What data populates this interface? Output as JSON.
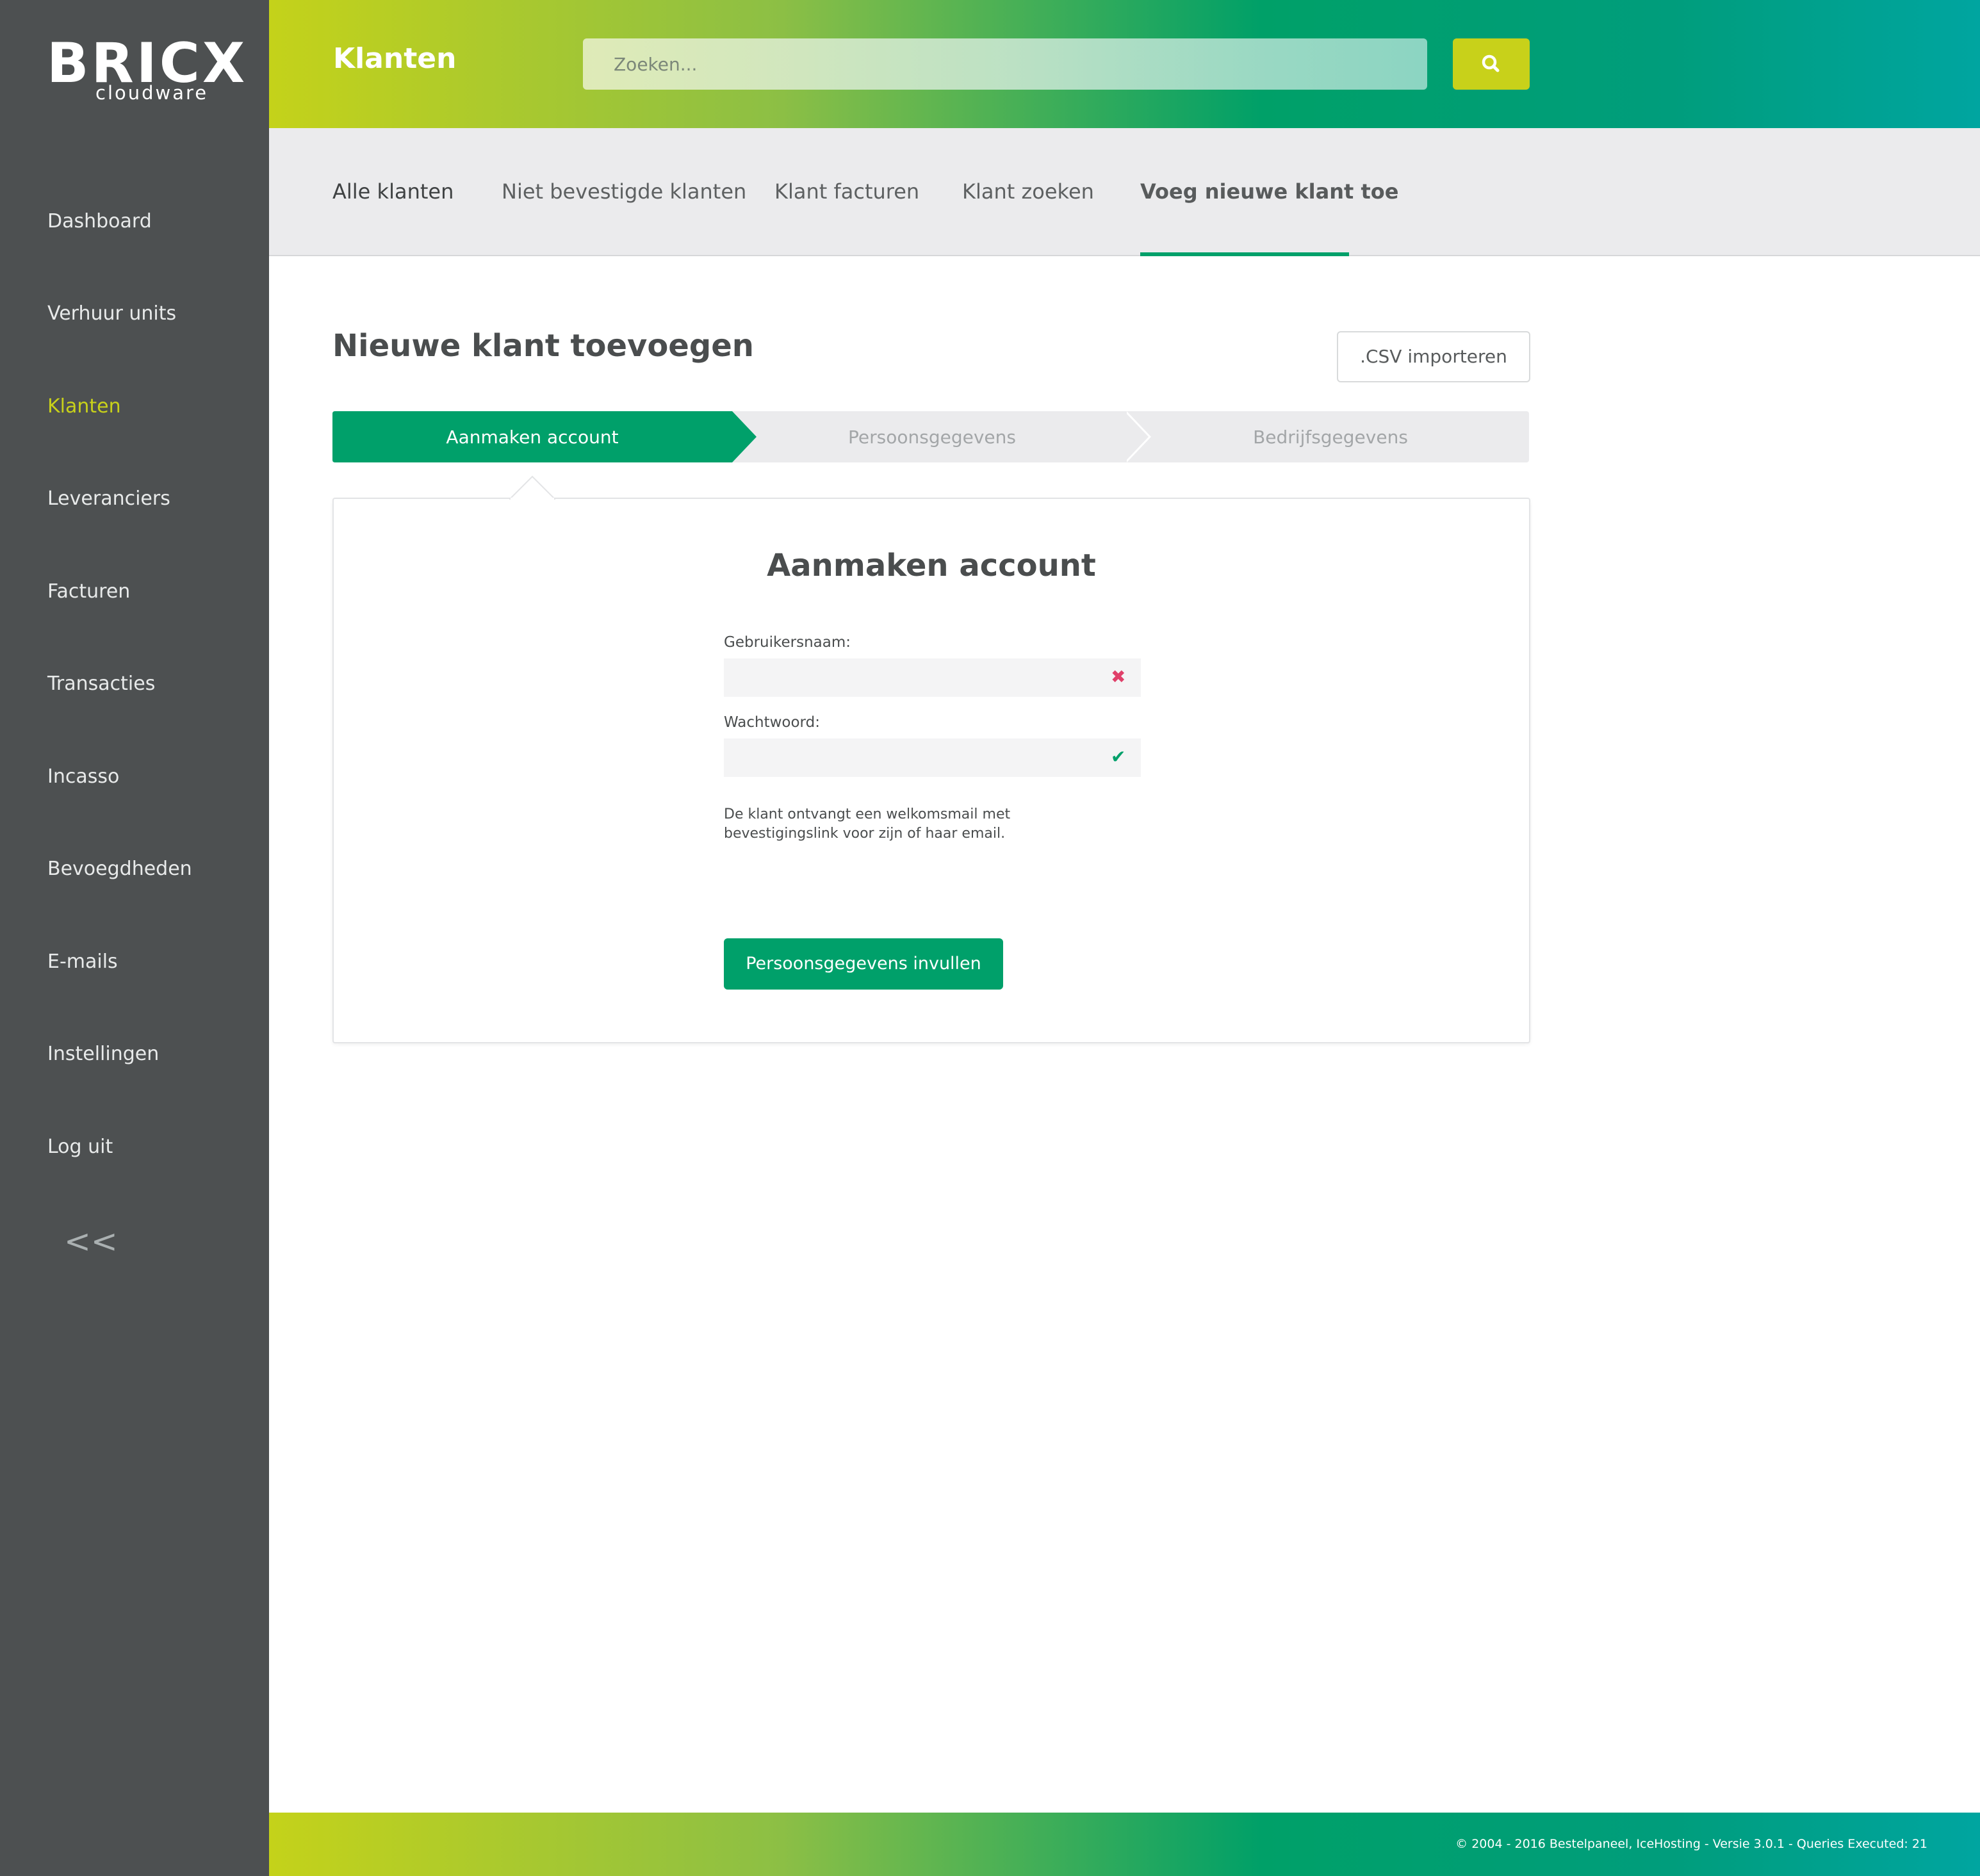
{
  "logo": {
    "main": "BRICX",
    "sub": "cloudware"
  },
  "sidebar": {
    "items": [
      {
        "label": "Dashboard"
      },
      {
        "label": "Verhuur units"
      },
      {
        "label": "Klanten",
        "active": true
      },
      {
        "label": "Leveranciers"
      },
      {
        "label": "Facturen"
      },
      {
        "label": "Transacties"
      },
      {
        "label": "Incasso"
      },
      {
        "label": "Bevoegdheden"
      },
      {
        "label": "E-mails"
      },
      {
        "label": "Instellingen"
      },
      {
        "label": "Log uit"
      }
    ],
    "collapse": "<<"
  },
  "header": {
    "title": "Klanten",
    "search_placeholder": "Zoeken...",
    "search_icon": "search-icon"
  },
  "tabs": [
    {
      "label": "Alle klanten"
    },
    {
      "label": "Niet bevestigde klanten"
    },
    {
      "label": "Klant facturen"
    },
    {
      "label": "Klant zoeken"
    },
    {
      "label": "Voeg nieuwe klant toe",
      "active": true
    }
  ],
  "page": {
    "title": "Nieuwe klant toevoegen",
    "csv_button": ".CSV importeren"
  },
  "wizard": {
    "steps": [
      {
        "label": "Aanmaken account",
        "active": true
      },
      {
        "label": "Persoonsgegevens",
        "active": false
      },
      {
        "label": "Bedrijfsgegevens",
        "active": false
      }
    ]
  },
  "form": {
    "title": "Aanmaken account",
    "username_label": "Gebruikersnaam:",
    "username_value": "",
    "username_status": "invalid",
    "password_label": "Wachtwoord:",
    "password_value": "",
    "password_status": "valid",
    "note_line1": "De klant ontvangt een welkomsmail met",
    "note_line2": "bevestigingslink voor zijn of haar email.",
    "submit": "Persoonsgegevens invullen"
  },
  "colors": {
    "accent_green": "#00a06a",
    "accent_lime": "#c8d11a",
    "error": "#e0406a",
    "sidebar_bg": "#4d5051"
  },
  "footer": {
    "text": "© 2004 - 2016 Bestelpaneel, IceHosting - Versie 3.0.1 - Queries Executed: 21"
  }
}
